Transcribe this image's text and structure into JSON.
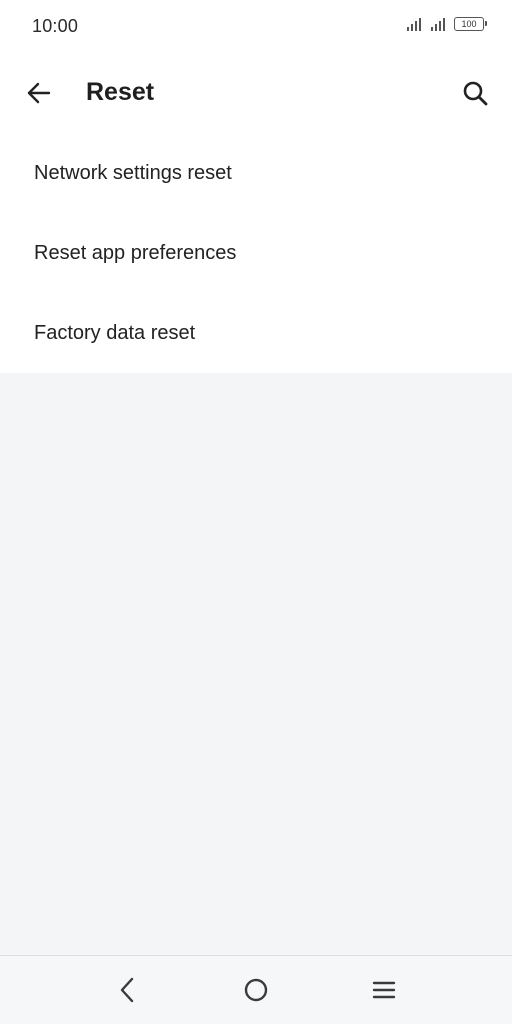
{
  "status_bar": {
    "time": "10:00",
    "battery_level": "100",
    "icons": [
      "signal-icon",
      "signal-icon",
      "battery-icon"
    ]
  },
  "app_bar": {
    "title": "Reset",
    "icons": [
      "back-arrow-icon",
      "search-icon"
    ]
  },
  "list": {
    "items": [
      {
        "label": "Network settings reset"
      },
      {
        "label": "Reset app preferences"
      },
      {
        "label": "Factory data reset"
      }
    ]
  },
  "nav_bar": {
    "icons": [
      "nav-back-icon",
      "nav-home-icon",
      "nav-menu-icon"
    ]
  },
  "colors": {
    "background": "#f4f5f7",
    "surface": "#ffffff",
    "text": "#1f1f1f",
    "icon": "#222222"
  }
}
